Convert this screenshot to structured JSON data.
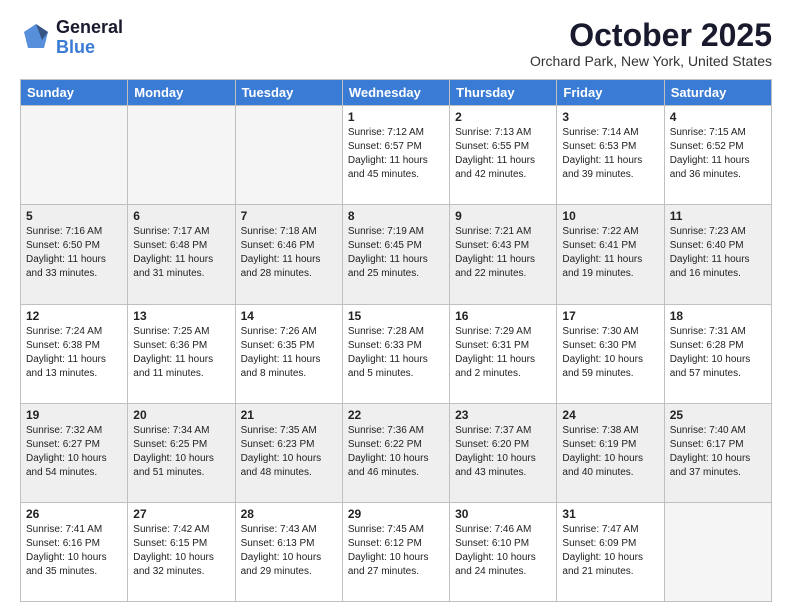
{
  "header": {
    "logo_general": "General",
    "logo_blue": "Blue",
    "month_title": "October 2025",
    "location": "Orchard Park, New York, United States"
  },
  "days_of_week": [
    "Sunday",
    "Monday",
    "Tuesday",
    "Wednesday",
    "Thursday",
    "Friday",
    "Saturday"
  ],
  "weeks": [
    [
      {
        "day": "",
        "info": ""
      },
      {
        "day": "",
        "info": ""
      },
      {
        "day": "",
        "info": ""
      },
      {
        "day": "1",
        "info": "Sunrise: 7:12 AM\nSunset: 6:57 PM\nDaylight: 11 hours and 45 minutes."
      },
      {
        "day": "2",
        "info": "Sunrise: 7:13 AM\nSunset: 6:55 PM\nDaylight: 11 hours and 42 minutes."
      },
      {
        "day": "3",
        "info": "Sunrise: 7:14 AM\nSunset: 6:53 PM\nDaylight: 11 hours and 39 minutes."
      },
      {
        "day": "4",
        "info": "Sunrise: 7:15 AM\nSunset: 6:52 PM\nDaylight: 11 hours and 36 minutes."
      }
    ],
    [
      {
        "day": "5",
        "info": "Sunrise: 7:16 AM\nSunset: 6:50 PM\nDaylight: 11 hours and 33 minutes."
      },
      {
        "day": "6",
        "info": "Sunrise: 7:17 AM\nSunset: 6:48 PM\nDaylight: 11 hours and 31 minutes."
      },
      {
        "day": "7",
        "info": "Sunrise: 7:18 AM\nSunset: 6:46 PM\nDaylight: 11 hours and 28 minutes."
      },
      {
        "day": "8",
        "info": "Sunrise: 7:19 AM\nSunset: 6:45 PM\nDaylight: 11 hours and 25 minutes."
      },
      {
        "day": "9",
        "info": "Sunrise: 7:21 AM\nSunset: 6:43 PM\nDaylight: 11 hours and 22 minutes."
      },
      {
        "day": "10",
        "info": "Sunrise: 7:22 AM\nSunset: 6:41 PM\nDaylight: 11 hours and 19 minutes."
      },
      {
        "day": "11",
        "info": "Sunrise: 7:23 AM\nSunset: 6:40 PM\nDaylight: 11 hours and 16 minutes."
      }
    ],
    [
      {
        "day": "12",
        "info": "Sunrise: 7:24 AM\nSunset: 6:38 PM\nDaylight: 11 hours and 13 minutes."
      },
      {
        "day": "13",
        "info": "Sunrise: 7:25 AM\nSunset: 6:36 PM\nDaylight: 11 hours and 11 minutes."
      },
      {
        "day": "14",
        "info": "Sunrise: 7:26 AM\nSunset: 6:35 PM\nDaylight: 11 hours and 8 minutes."
      },
      {
        "day": "15",
        "info": "Sunrise: 7:28 AM\nSunset: 6:33 PM\nDaylight: 11 hours and 5 minutes."
      },
      {
        "day": "16",
        "info": "Sunrise: 7:29 AM\nSunset: 6:31 PM\nDaylight: 11 hours and 2 minutes."
      },
      {
        "day": "17",
        "info": "Sunrise: 7:30 AM\nSunset: 6:30 PM\nDaylight: 10 hours and 59 minutes."
      },
      {
        "day": "18",
        "info": "Sunrise: 7:31 AM\nSunset: 6:28 PM\nDaylight: 10 hours and 57 minutes."
      }
    ],
    [
      {
        "day": "19",
        "info": "Sunrise: 7:32 AM\nSunset: 6:27 PM\nDaylight: 10 hours and 54 minutes."
      },
      {
        "day": "20",
        "info": "Sunrise: 7:34 AM\nSunset: 6:25 PM\nDaylight: 10 hours and 51 minutes."
      },
      {
        "day": "21",
        "info": "Sunrise: 7:35 AM\nSunset: 6:23 PM\nDaylight: 10 hours and 48 minutes."
      },
      {
        "day": "22",
        "info": "Sunrise: 7:36 AM\nSunset: 6:22 PM\nDaylight: 10 hours and 46 minutes."
      },
      {
        "day": "23",
        "info": "Sunrise: 7:37 AM\nSunset: 6:20 PM\nDaylight: 10 hours and 43 minutes."
      },
      {
        "day": "24",
        "info": "Sunrise: 7:38 AM\nSunset: 6:19 PM\nDaylight: 10 hours and 40 minutes."
      },
      {
        "day": "25",
        "info": "Sunrise: 7:40 AM\nSunset: 6:17 PM\nDaylight: 10 hours and 37 minutes."
      }
    ],
    [
      {
        "day": "26",
        "info": "Sunrise: 7:41 AM\nSunset: 6:16 PM\nDaylight: 10 hours and 35 minutes."
      },
      {
        "day": "27",
        "info": "Sunrise: 7:42 AM\nSunset: 6:15 PM\nDaylight: 10 hours and 32 minutes."
      },
      {
        "day": "28",
        "info": "Sunrise: 7:43 AM\nSunset: 6:13 PM\nDaylight: 10 hours and 29 minutes."
      },
      {
        "day": "29",
        "info": "Sunrise: 7:45 AM\nSunset: 6:12 PM\nDaylight: 10 hours and 27 minutes."
      },
      {
        "day": "30",
        "info": "Sunrise: 7:46 AM\nSunset: 6:10 PM\nDaylight: 10 hours and 24 minutes."
      },
      {
        "day": "31",
        "info": "Sunrise: 7:47 AM\nSunset: 6:09 PM\nDaylight: 10 hours and 21 minutes."
      },
      {
        "day": "",
        "info": ""
      }
    ]
  ]
}
